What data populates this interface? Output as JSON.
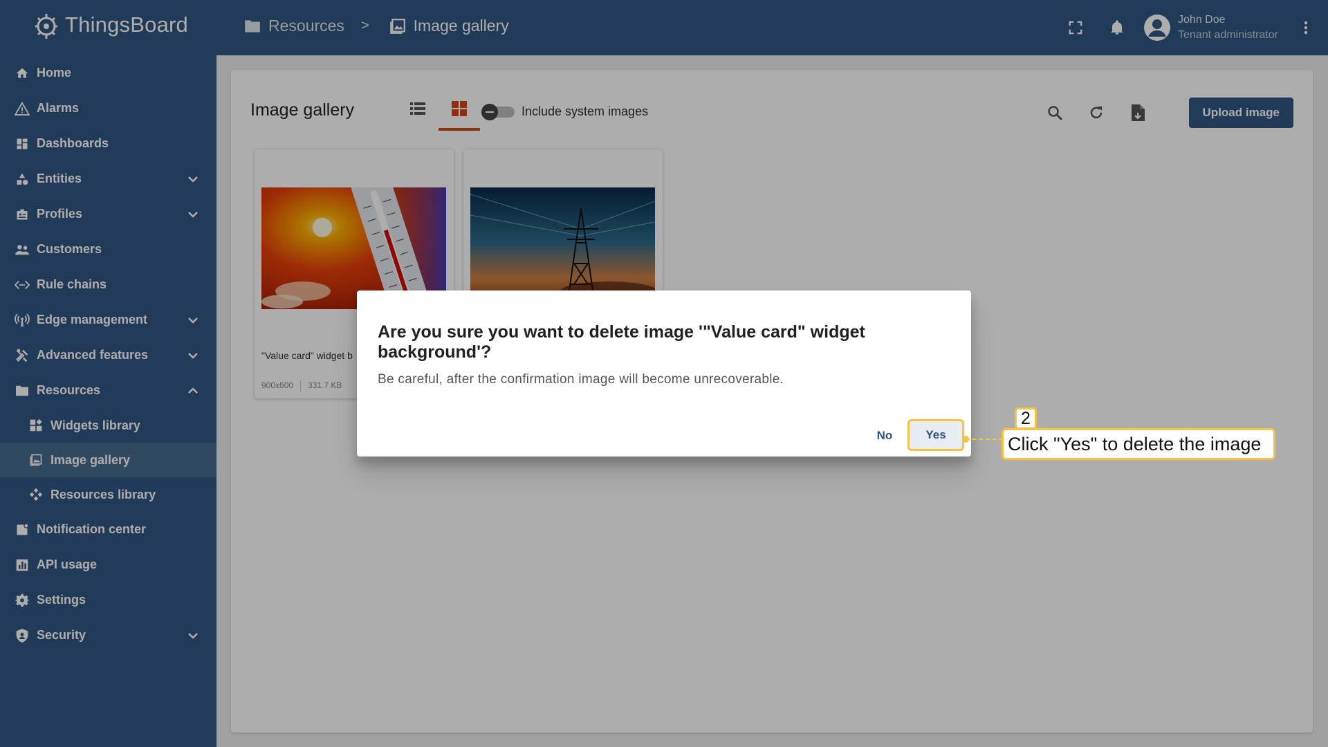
{
  "app": {
    "name": "ThingsBoard"
  },
  "breadcrumb": {
    "parent": "Resources",
    "separator": ">",
    "current": "Image gallery"
  },
  "user": {
    "name": "John Doe",
    "role": "Tenant administrator"
  },
  "sidebar": {
    "items": [
      {
        "label": "Home",
        "icon": "home-icon"
      },
      {
        "label": "Alarms",
        "icon": "warning-icon"
      },
      {
        "label": "Dashboards",
        "icon": "dashboard-icon"
      },
      {
        "label": "Entities",
        "icon": "entities-icon",
        "expandable": true
      },
      {
        "label": "Profiles",
        "icon": "profiles-icon",
        "expandable": true
      },
      {
        "label": "Customers",
        "icon": "customers-icon"
      },
      {
        "label": "Rule chains",
        "icon": "rule-chains-icon"
      },
      {
        "label": "Edge management",
        "icon": "edge-icon",
        "expandable": true
      },
      {
        "label": "Advanced features",
        "icon": "tools-icon",
        "expandable": true
      },
      {
        "label": "Resources",
        "icon": "folder-icon",
        "expanded": true
      },
      {
        "label": "Widgets library",
        "icon": "widgets-icon",
        "sub": true
      },
      {
        "label": "Image gallery",
        "icon": "image-icon",
        "sub": true,
        "selected": true
      },
      {
        "label": "Resources library",
        "icon": "resources-icon",
        "sub": true
      },
      {
        "label": "Notification center",
        "icon": "notification-icon"
      },
      {
        "label": "API usage",
        "icon": "chart-icon"
      },
      {
        "label": "Settings",
        "icon": "gear-icon"
      },
      {
        "label": "Security",
        "icon": "shield-icon",
        "expandable": true
      }
    ]
  },
  "gallery": {
    "title": "Image gallery",
    "include_system_label": "Include system images",
    "include_system_on": false,
    "upload_label": "Upload image",
    "images": [
      {
        "name": "\"Value card\" widget b",
        "resolution": "900x600",
        "size": "331.7 KB",
        "picture": "thermometer-sun"
      },
      {
        "name": "",
        "resolution": "",
        "size": "",
        "picture": "power-tower-sunset"
      }
    ]
  },
  "dialog": {
    "title": "Are you sure you want to delete image '\"Value card\" widget background'?",
    "message": "Be careful, after the confirmation image will become unrecoverable.",
    "no_label": "No",
    "yes_label": "Yes"
  },
  "callout": {
    "step": "2",
    "text": "Click \"Yes\" to delete the image"
  },
  "colors": {
    "primary": "#305680",
    "accent": "#d84315",
    "highlight": "#f5c242"
  }
}
